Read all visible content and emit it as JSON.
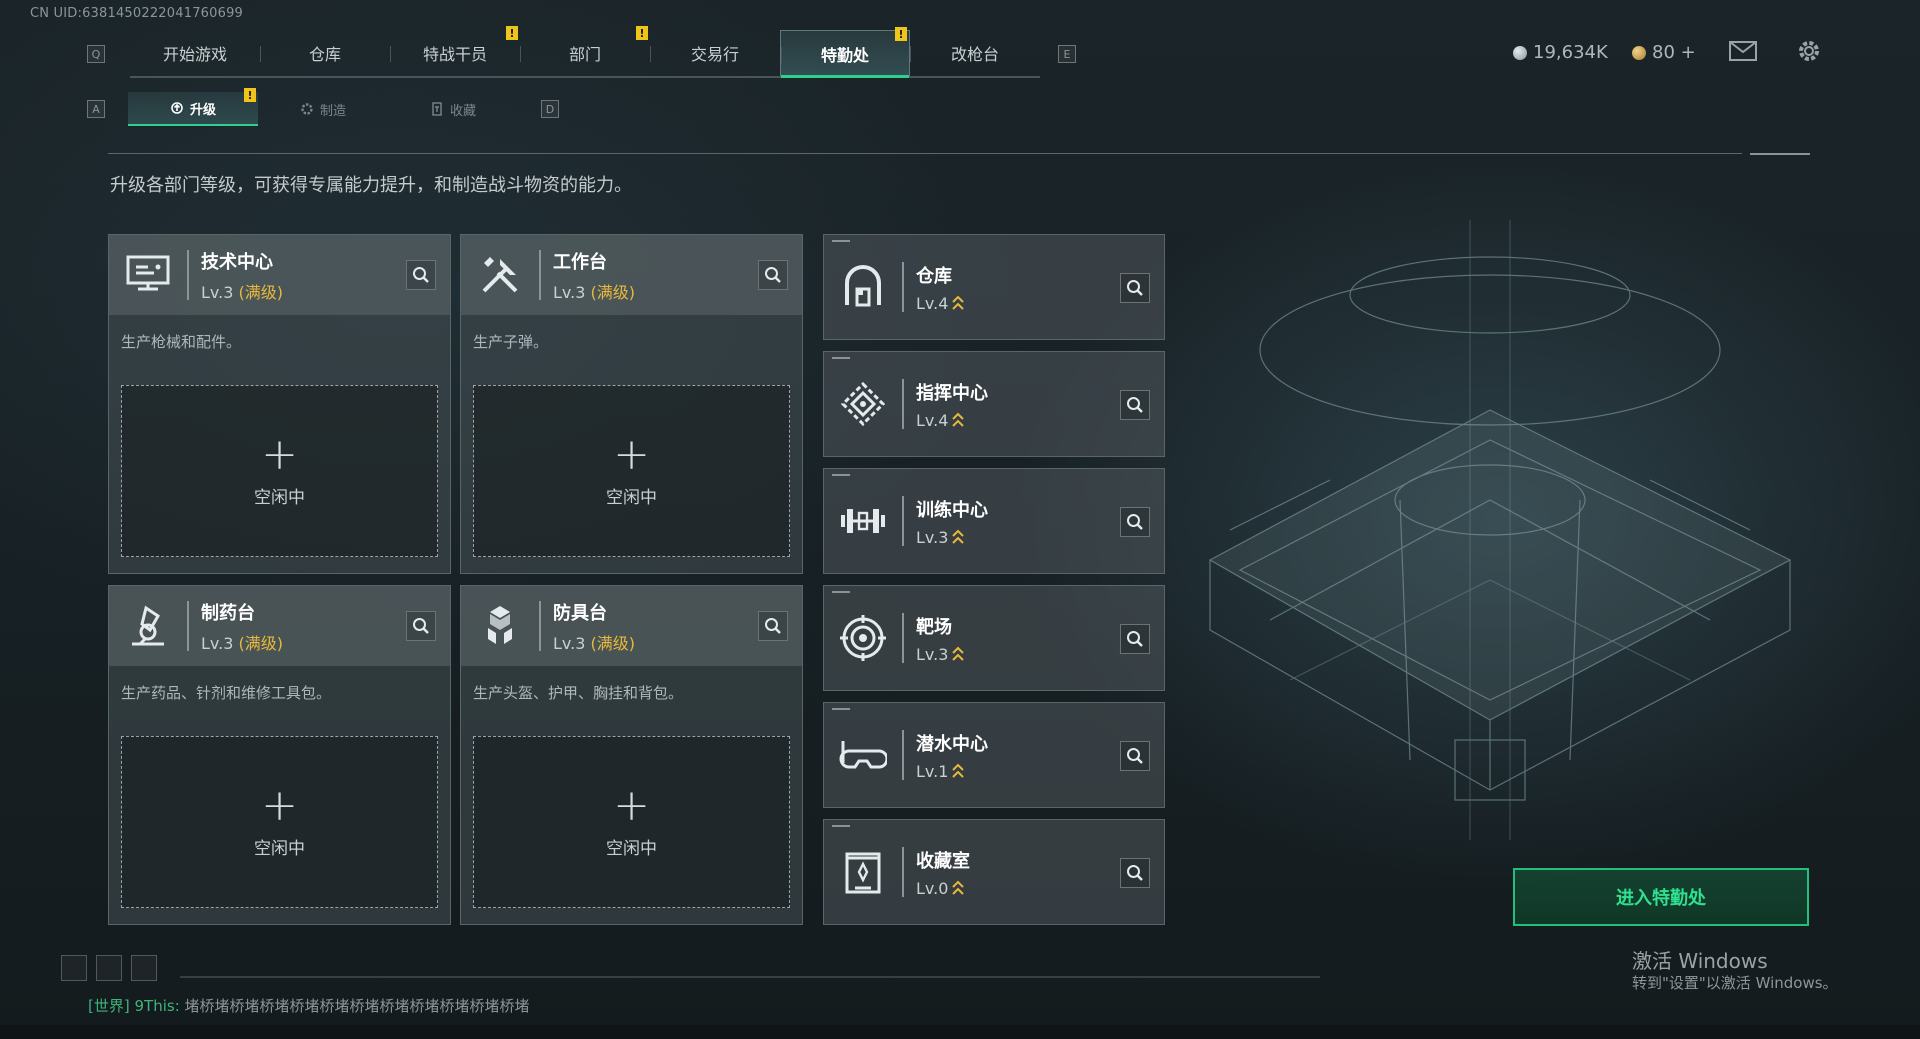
{
  "uid_text": "CN UID:6381450222041760699",
  "top_nav": {
    "left_key": "Q",
    "right_key": "E",
    "tabs": [
      {
        "label": "开始游戏",
        "badge": ""
      },
      {
        "label": "仓库",
        "badge": ""
      },
      {
        "label": "特战干员",
        "badge": "!"
      },
      {
        "label": "部门",
        "badge": "!"
      },
      {
        "label": "交易行",
        "badge": ""
      },
      {
        "label": "特勤处",
        "badge": "!",
        "active": true
      },
      {
        "label": "改枪台",
        "badge": ""
      }
    ]
  },
  "currency": {
    "silver": "19,634K",
    "gold": "80 +",
    "silver_color": "#b7bfc2",
    "gold_color": "#c9a04a"
  },
  "sub_nav": {
    "left_key": "A",
    "right_key": "D",
    "tabs": [
      {
        "label": "升级",
        "icon": "upgrade-icon",
        "badge": "!",
        "active": true
      },
      {
        "label": "制造",
        "icon": "gear-icon"
      },
      {
        "label": "收藏",
        "icon": "trophy-icon"
      }
    ]
  },
  "description": "升级各部门等级，可获得专属能力提升，和制造战斗物资的能力。",
  "production_stations": [
    {
      "name": "技术中心",
      "level": "Lv.3",
      "status": "(满级)",
      "desc": "生产枪械和配件。",
      "slot_plus": "+",
      "slot_label": "空闲中",
      "icon": "monitor-icon"
    },
    {
      "name": "工作台",
      "level": "Lv.3",
      "status": "(满级)",
      "desc": "生产子弹。",
      "slot_plus": "+",
      "slot_label": "空闲中",
      "icon": "tools-icon"
    },
    {
      "name": "制药台",
      "level": "Lv.3",
      "status": "(满级)",
      "desc": "生产药品、针剂和维修工具包。",
      "slot_plus": "+",
      "slot_label": "空闲中",
      "icon": "microscope-icon"
    },
    {
      "name": "防具台",
      "level": "Lv.3",
      "status": "(满级)",
      "desc": "生产头盔、护甲、胸挂和背包。",
      "slot_plus": "+",
      "slot_label": "空闲中",
      "icon": "cubes-icon"
    }
  ],
  "facilities": [
    {
      "name": "仓库",
      "level": "Lv.4",
      "icon": "warehouse-icon"
    },
    {
      "name": "指挥中心",
      "level": "Lv.4",
      "icon": "command-icon"
    },
    {
      "name": "训练中心",
      "level": "Lv.3",
      "icon": "dumbbell-icon"
    },
    {
      "name": "靶场",
      "level": "Lv.3",
      "icon": "target-icon"
    },
    {
      "name": "潜水中心",
      "level": "Lv.1",
      "icon": "goggles-icon"
    },
    {
      "name": "收藏室",
      "level": "Lv.0",
      "icon": "trophy-case-icon"
    }
  ],
  "enter_button": "进入特勤处",
  "watermark": {
    "line1": "激活 Windows",
    "line2": "转到\"设置\"以激活 Windows。"
  },
  "chat": {
    "channel": "[世界]",
    "user": "9This:",
    "message": "堵桥堵桥堵桥堵桥堵桥堵桥堵桥堵桥堵桥堵桥堵桥堵"
  },
  "accent_color": "#2fd08b",
  "badge_color": "#f0c419"
}
